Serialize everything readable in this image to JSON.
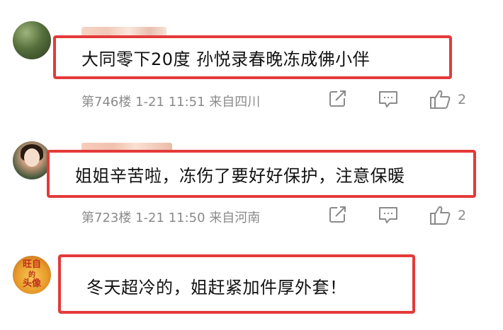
{
  "comments": [
    {
      "text": "大同零下20度 孙悦录春晚冻成佛小伴",
      "floor": "第746楼",
      "date": "1-21",
      "time": "11:51",
      "location": "来自四川",
      "like_count": "2"
    },
    {
      "text": "姐姐辛苦啦，冻伤了要好好保护，注意保暖",
      "floor": "第723楼",
      "date": "1-21",
      "time": "11:50",
      "location": "来自河南",
      "like_count": "2"
    },
    {
      "text": "冬天超冷的，姐赶紧加件厚外套！",
      "avatar_text": [
        "旺自",
        "的",
        "头像"
      ]
    }
  ],
  "icons": {
    "share": "share-icon",
    "comment": "comment-icon",
    "like": "thumbs-up-icon"
  },
  "colors": {
    "highlight_border": "#e43a3a",
    "meta_text": "#8a8a8a"
  }
}
